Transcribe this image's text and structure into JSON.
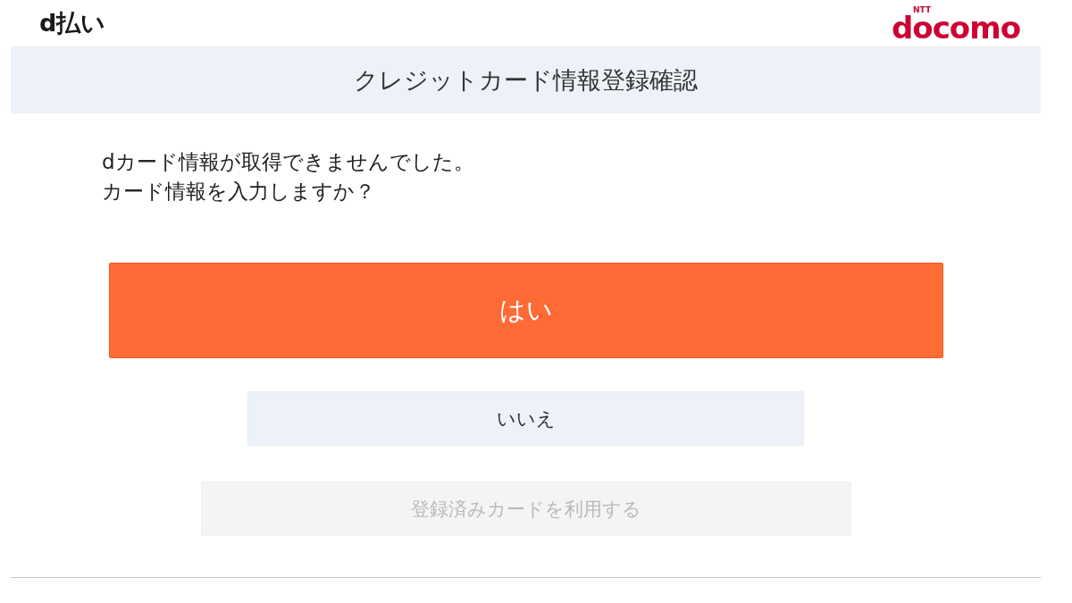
{
  "header": {
    "logo": {
      "text": "d払い"
    },
    "brand": {
      "small": "NTT",
      "text": "docomo"
    }
  },
  "title_bar": {
    "title": "クレジットカード情報登録確認"
  },
  "message": [
    "dカード情報が取得できませんでした。",
    "カード情報を入力しますか？"
  ],
  "buttons": [
    {
      "label": "はい",
      "kind": "primary",
      "disabled": false
    },
    {
      "label": "いいえ",
      "kind": "secondary",
      "disabled": false
    },
    {
      "label": "登録済みカードを利用する",
      "kind": "secondary",
      "disabled": true
    }
  ]
}
